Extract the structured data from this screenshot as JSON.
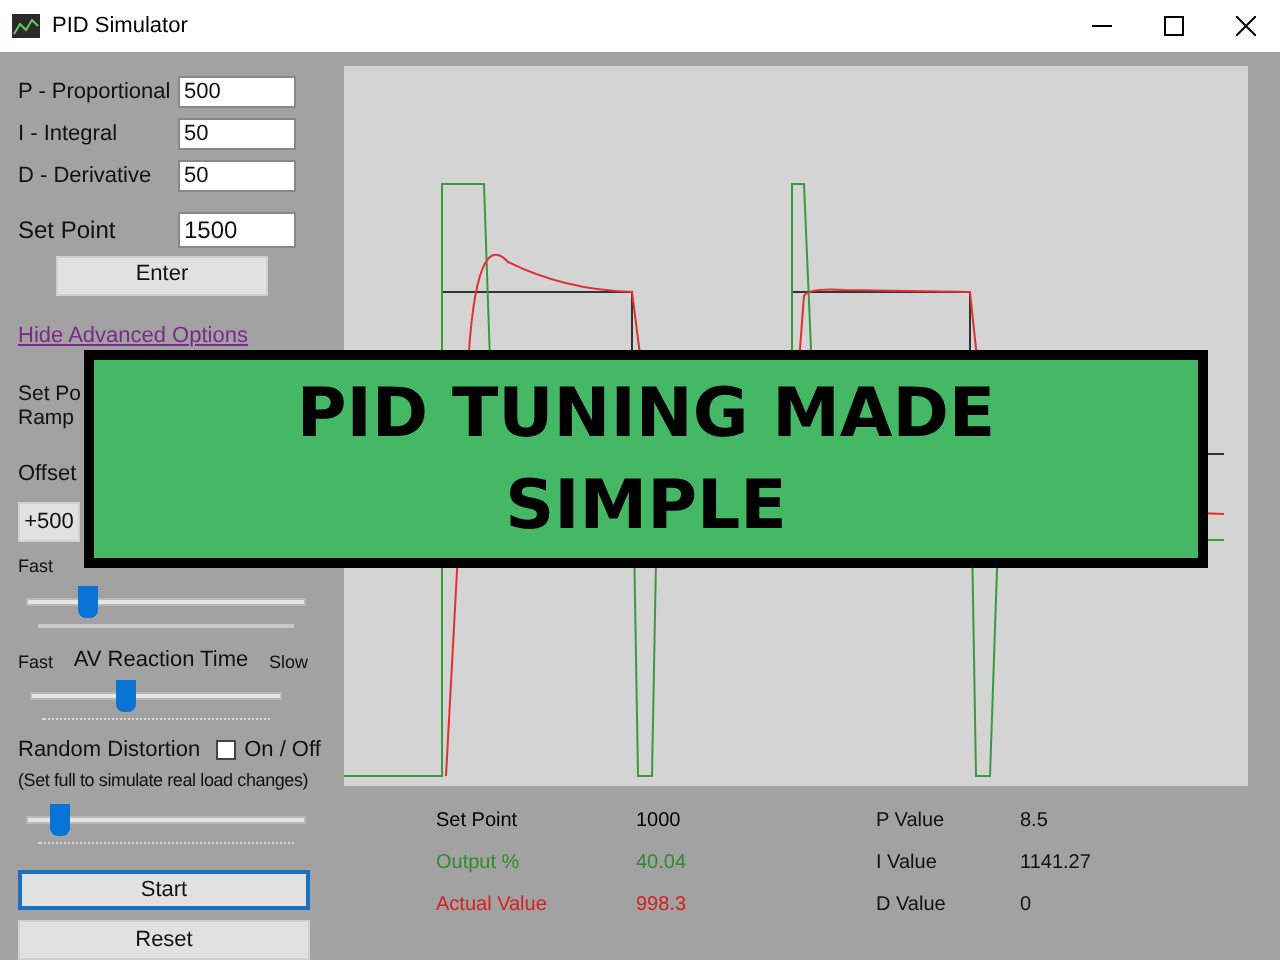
{
  "window": {
    "title": "PID Simulator"
  },
  "gains": [
    {
      "label": "P - Proportional",
      "value": "500"
    },
    {
      "label": "I - Integral",
      "value": "50"
    },
    {
      "label": "D - Derivative",
      "value": "50"
    }
  ],
  "set_point": {
    "label": "Set Point",
    "value": "1500"
  },
  "enter_button": "Enter",
  "advanced_link": "Hide Advanced Options",
  "ramp": {
    "label_1": "Set Po",
    "label_2": "Ramp"
  },
  "offset": {
    "label": "Offset",
    "buttons": [
      "+500"
    ]
  },
  "graph_speed": {
    "left": "Fast",
    "level": 0.22
  },
  "reaction": {
    "label": "AV Reaction Time",
    "left": "Fast",
    "right": "Slow",
    "level": 0.38
  },
  "distortion": {
    "label": "Random Distortion",
    "toggle_label": "On / Off",
    "checked": false,
    "hint": "(Set full to simulate real load changes)",
    "level": 0.12
  },
  "buttons": [
    {
      "label": "Start",
      "focused": true
    },
    {
      "label": "Reset",
      "focused": false
    }
  ],
  "readouts": [
    {
      "label": "Set Point",
      "value": "1000",
      "color": "#000000"
    },
    {
      "label": "Output  %",
      "value": "40.04",
      "color": "#2e8b2e"
    },
    {
      "label": "Actual Value",
      "value": "998.3",
      "color": "#d42020"
    }
  ],
  "pid_values": [
    {
      "label": "P Value",
      "value": "8.5"
    },
    {
      "label": "I Value",
      "value": "1141.27"
    },
    {
      "label": "D Value",
      "value": "0"
    }
  ],
  "banner": {
    "lines": [
      "PID TUNING MADE",
      "SIMPLE"
    ]
  }
}
